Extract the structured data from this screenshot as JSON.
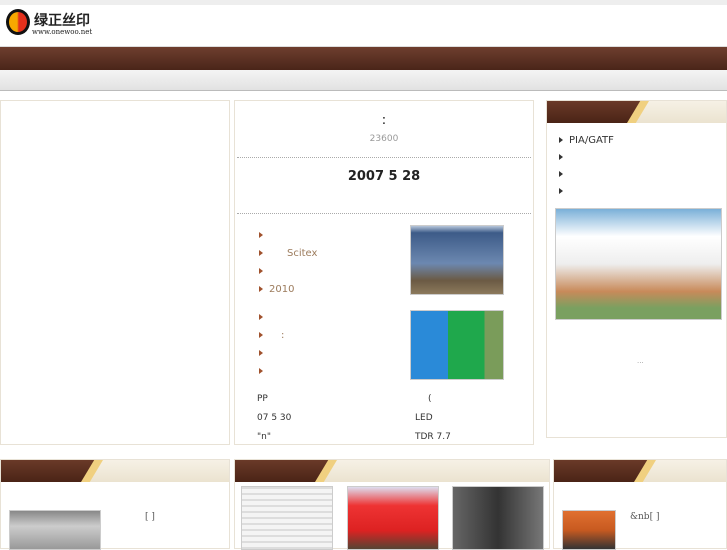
{
  "header": {
    "logo_text": "绿正丝印",
    "logo_url": "www.onewoo.net"
  },
  "center": {
    "colon": ":",
    "count": "23600",
    "date": "2007 5 28",
    "list1": [
      "",
      "Scitex",
      "",
      "2010"
    ],
    "list2": [
      "",
      ":",
      "",
      ""
    ],
    "rows": [
      [
        "PP",
        "("
      ],
      [
        "07 5 30",
        "LED"
      ],
      [
        "\"n\"",
        "TDR  7.7"
      ]
    ]
  },
  "right": {
    "items": [
      "PIA/GATF",
      "",
      "",
      ""
    ],
    "more": "..."
  },
  "bottom": {
    "left_bracket": "[  ]",
    "right_bracket": "&nb[  ]"
  }
}
